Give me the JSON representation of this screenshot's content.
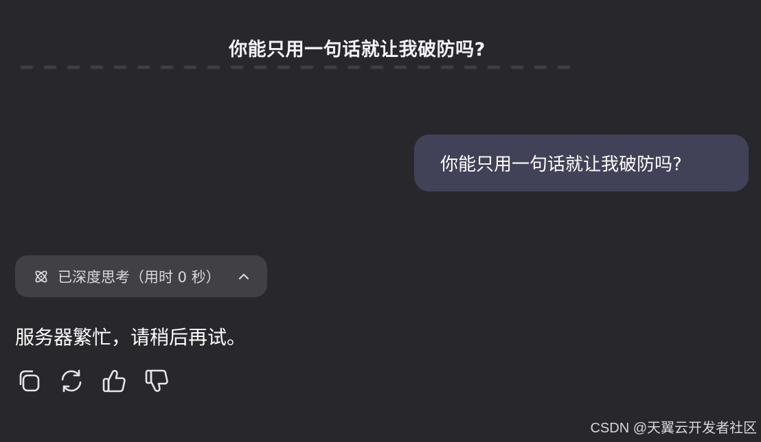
{
  "header": {
    "title": "你能只用一句话就让我破防吗?"
  },
  "conversation": {
    "user_message": "你能只用一句话就让我破防吗?",
    "thinking": {
      "label": "已深度思考（用时 0 秒）",
      "icon": "atom-icon",
      "toggle_icon": "chevron-up-icon"
    },
    "reply": "服务器繁忙，请稍后再试。",
    "actions": [
      {
        "name": "copy",
        "icon": "copy-icon"
      },
      {
        "name": "regenerate",
        "icon": "refresh-icon"
      },
      {
        "name": "like",
        "icon": "thumbs-up-icon"
      },
      {
        "name": "dislike",
        "icon": "thumbs-down-icon"
      }
    ]
  },
  "watermark": "CSDN @天翼云开发者社区",
  "colors": {
    "background": "#28282c",
    "user_bubble": "#414158",
    "think_pill": "#414145",
    "text": "#ffffff"
  }
}
